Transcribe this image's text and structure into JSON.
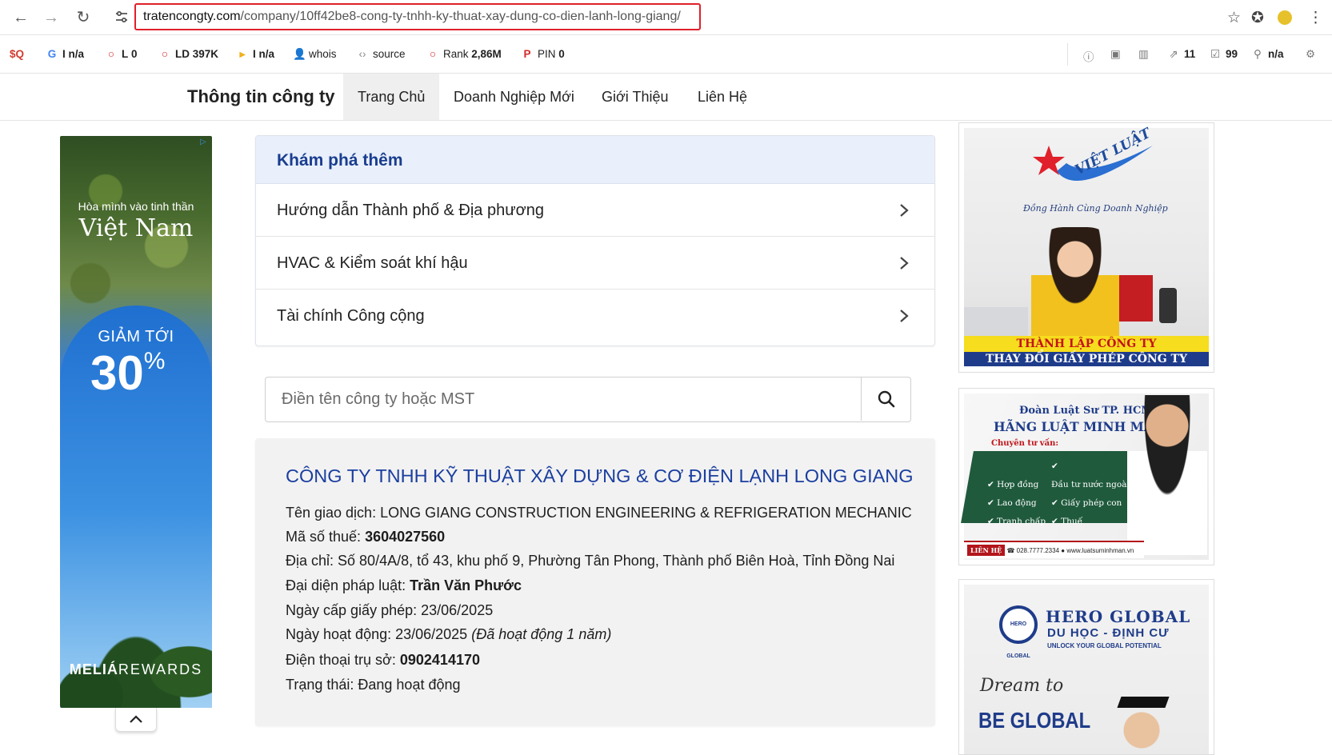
{
  "browser": {
    "url_host": "tratencongty.com",
    "url_path": "/company/10ff42be8-cong-ty-tnhh-ky-thuat-xay-dung-co-dien-lanh-long-giang/"
  },
  "extensions": {
    "items": [
      {
        "icon": "G",
        "label": "",
        "value": "n/a"
      },
      {
        "icon": "○",
        "label": "L",
        "value": "0"
      },
      {
        "icon": "○",
        "label": "LD",
        "value": "397K"
      },
      {
        "icon": "▸",
        "label": "",
        "value": "n/a"
      },
      {
        "icon": "👤",
        "label": "whois",
        "value": ""
      },
      {
        "icon": "‹›",
        "label": "source",
        "value": ""
      },
      {
        "icon": "○",
        "label": "Rank",
        "value": "2,86M"
      },
      {
        "icon": "P",
        "label": "PIN",
        "value": "0"
      }
    ],
    "right": [
      {
        "icon": "ⓘ",
        "value": ""
      },
      {
        "icon": "▣",
        "value": ""
      },
      {
        "icon": "▥",
        "value": ""
      },
      {
        "icon": "⇗",
        "value": "11"
      },
      {
        "icon": "☑",
        "value": "99"
      },
      {
        "icon": "⚲",
        "value": "n/a"
      }
    ]
  },
  "site": {
    "brand": "Thông tin công ty",
    "menu": [
      "Trang Chủ",
      "Doanh Nghiệp Mới",
      "Giới Thiệu",
      "Liên Hệ"
    ]
  },
  "left_ad": {
    "line1": "Hòa mình vào tinh thần",
    "line2": "Việt Nam",
    "line3": "GIẢM TỚI",
    "line4": "30",
    "line4_unit": "%",
    "brand_a": "MELIÁ",
    "brand_b": "REWARDS"
  },
  "explore": {
    "title": "Khám phá thêm",
    "rows": [
      "Hướng dẫn Thành phố & Địa phương",
      "HVAC & Kiểm soát khí hậu",
      "Tài chính Công cộng"
    ]
  },
  "search": {
    "placeholder": "Điền tên công ty hoặc MST"
  },
  "company": {
    "name": "CÔNG TY TNHH KỸ THUẬT XÂY DỰNG & CƠ ĐIỆN LẠNH LONG GIANG",
    "trade_name_label": "Tên giao dịch: ",
    "trade_name": "LONG GIANG CONSTRUCTION ENGINEERING & REFRIGERATION MECHANIC",
    "tax_label": "Mã số thuế: ",
    "tax": "3604027560",
    "address_label": "Địa chỉ: ",
    "address": "Số 80/4A/8, tổ 43, khu phố 9, Phường Tân Phong, Thành phố Biên Hoà, Tỉnh Đồng Nai",
    "rep_label": "Đại diện pháp luật: ",
    "rep": "Trần Văn Phước",
    "license_label": "Ngày cấp giấy phép: ",
    "license": "23/06/2025",
    "active_label": "Ngày hoạt động: ",
    "active": "23/06/2025",
    "active_note": "(Đã hoạt động 1 năm)",
    "phone_label": "Điện thoại trụ sở: ",
    "phone": "0902414170",
    "status_label": "Trạng thái: ",
    "status": "Đang hoạt động"
  },
  "right_ads": {
    "ad1": {
      "arc": "VIỆT LUẬT",
      "script": "Đồng Hành Cùng Doanh Nghiệp",
      "band1": "THÀNH LẬP CÔNG TY",
      "band2": "THAY ĐỔI GIẤY PHÉP CÔNG TY"
    },
    "ad2": {
      "t1": "Đoàn Luật Sư TP. HCM",
      "t2": "HÃNG LUẬT MINH MẪN",
      "t3": "Chuyên tư vấn:",
      "bullets": [
        "Hợp đồng",
        "Đầu tư nước ngoài",
        "Lao động",
        "Giấy phép con",
        "Tranh chấp",
        "Thuế"
      ],
      "foot_label": "LIÊN HỆ",
      "foot_phone": "028.7777.2334",
      "foot_site": "www.luatsuminhman.vn"
    },
    "ad3": {
      "logo": "HERO GLOBAL",
      "h1": "HERO GLOBAL",
      "h2": "DU HỌC - ĐỊNH CƯ",
      "h3": "UNLOCK YOUR GLOBAL POTENTIAL",
      "dream": "Dream to",
      "be": "BE GLOBAL"
    }
  },
  "colors": {
    "link_blue": "#1b3fa0",
    "highlight_red": "#e0202a",
    "explore_head_bg": "#e9f0fb"
  }
}
